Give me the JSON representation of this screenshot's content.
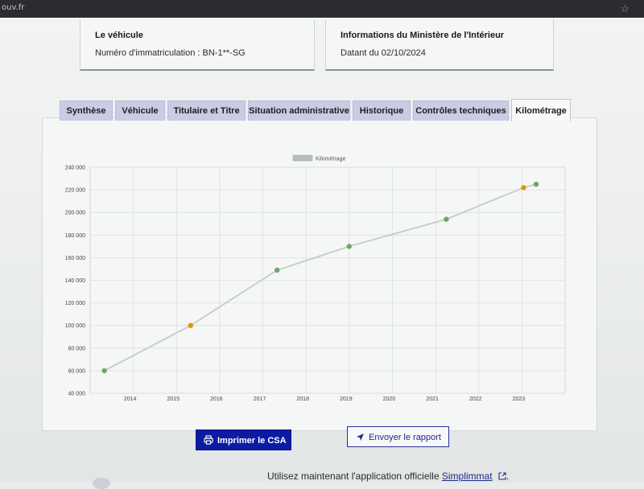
{
  "browser": {
    "url_fragment": "ouv.fr"
  },
  "vehicle_card": {
    "title": "Le véhicule",
    "registration": "Numéro d'immatriculation : BN-1**-SG"
  },
  "ministry_card": {
    "title": "Informations du Ministère de l'Intérieur",
    "date": "Datant du 02/10/2024"
  },
  "tabs": [
    {
      "label": "Synthèse",
      "active": false
    },
    {
      "label": "Véhicule",
      "active": false
    },
    {
      "label": "Titulaire et Titre",
      "active": false
    },
    {
      "label": "Situation administrative",
      "active": false
    },
    {
      "label": "Historique",
      "active": false
    },
    {
      "label": "Contrôles techniques",
      "active": false
    },
    {
      "label": "Kilométrage",
      "active": true
    }
  ],
  "chart_data": {
    "type": "line",
    "title": "",
    "xlabel": "",
    "ylabel": "",
    "legend": [
      "Kilométrage"
    ],
    "legend_position": "top-center",
    "grid": true,
    "x_ticks": [
      "2014",
      "2015",
      "2016",
      "2017",
      "2018",
      "2019",
      "2020",
      "2021",
      "2022",
      "2023"
    ],
    "y_ticks": [
      "40 000",
      "60 000",
      "80 000",
      "100 000",
      "120 000",
      "140 000",
      "160 000",
      "180 000",
      "200 000",
      "220 000",
      "240 000"
    ],
    "ylim": [
      40000,
      240000
    ],
    "xlim": [
      "2013-01-01",
      "2024-01-01"
    ],
    "series": [
      {
        "name": "Kilométrage",
        "line_color": "#c5cbc7",
        "points": [
          {
            "x": "2013-05-01",
            "y": 60000,
            "color": "#6aa56d"
          },
          {
            "x": "2015-05-01",
            "y": 100000,
            "color": "#e0930e"
          },
          {
            "x": "2017-05-01",
            "y": 149000,
            "color": "#6aa56d"
          },
          {
            "x": "2019-01-01",
            "y": 170000,
            "color": "#6aa56d"
          },
          {
            "x": "2021-04-01",
            "y": 194000,
            "color": "#6aa56d"
          },
          {
            "x": "2023-01-15",
            "y": 222000,
            "color": "#e0930e"
          },
          {
            "x": "2023-05-01",
            "y": 225000,
            "color": "#6aa56d"
          }
        ]
      }
    ]
  },
  "actions": {
    "print_label": "Imprimer le CSA",
    "send_label": "Envoyer le rapport"
  },
  "footer": {
    "text": "Utilisez maintenant l'application officielle",
    "link": "Simplimmat"
  },
  "colors": {
    "accent": "#0b1ca3",
    "tab_bg": "#c9cce4",
    "point_green": "#6aa56d",
    "point_orange": "#e0930e"
  }
}
